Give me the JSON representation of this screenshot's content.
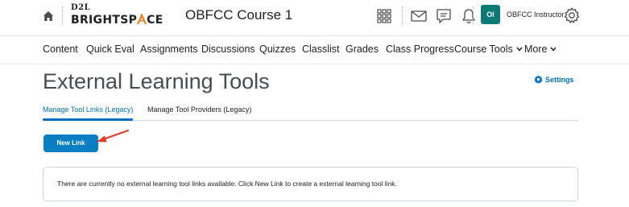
{
  "header": {
    "logo_top": "D2L",
    "logo_main_left": "BRIGHTSP",
    "logo_main_right": "CE",
    "course_title": "OBFCC Course 1",
    "user_initials": "OI",
    "user_name": "OBFCC Instructor"
  },
  "nav": {
    "items": [
      {
        "label": "Content"
      },
      {
        "label": "Quick Eval"
      },
      {
        "label": "Assignments"
      },
      {
        "label": "Discussions"
      },
      {
        "label": "Quizzes"
      },
      {
        "label": "Classlist"
      },
      {
        "label": "Grades"
      },
      {
        "label": "Class Progress"
      },
      {
        "label": "Course Tools",
        "dropdown": true
      },
      {
        "label": "More",
        "dropdown": true
      }
    ]
  },
  "page": {
    "title": "External Learning Tools",
    "settings_label": "Settings",
    "tabs": [
      {
        "label": "Manage Tool Links (Legacy)",
        "active": true
      },
      {
        "label": "Manage Tool Providers (Legacy)",
        "active": false
      }
    ],
    "new_link_label": "New Link",
    "empty_message": "There are currently no external learning tool links available. Click New Link to create a external learning tool link."
  },
  "colors": {
    "accent": "#006fbf",
    "button": "#0a7ec2",
    "avatar": "#0b7a75",
    "annotation_arrow": "#e53b2c"
  }
}
